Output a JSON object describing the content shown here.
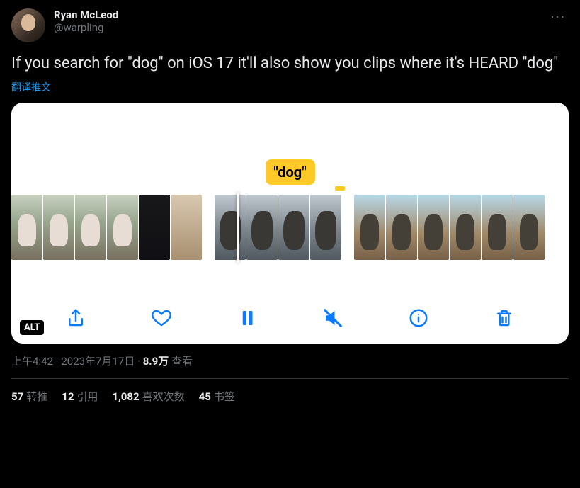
{
  "user": {
    "display_name": "Ryan McLeod",
    "handle": "@warpling"
  },
  "body": "If you search for \"dog\" on iOS 17 it'll also show you clips where it's HEARD \"dog\"",
  "translate_label": "翻译推文",
  "media": {
    "tag": "\"dog\"",
    "alt_label": "ALT",
    "controls": {
      "share": "share",
      "like": "like",
      "pause": "pause",
      "mute": "mute",
      "info": "info",
      "trash": "trash"
    }
  },
  "meta": {
    "time": "上午4:42",
    "sep": " · ",
    "date": "2023年7月17日",
    "views_value": "8.9万",
    "views_label": "查看"
  },
  "stats": {
    "retweets": {
      "n": "57",
      "label": "转推"
    },
    "quotes": {
      "n": "12",
      "label": "引用"
    },
    "likes": {
      "n": "1,082",
      "label": "喜欢次数"
    },
    "bookmarks": {
      "n": "45",
      "label": "书签"
    }
  }
}
